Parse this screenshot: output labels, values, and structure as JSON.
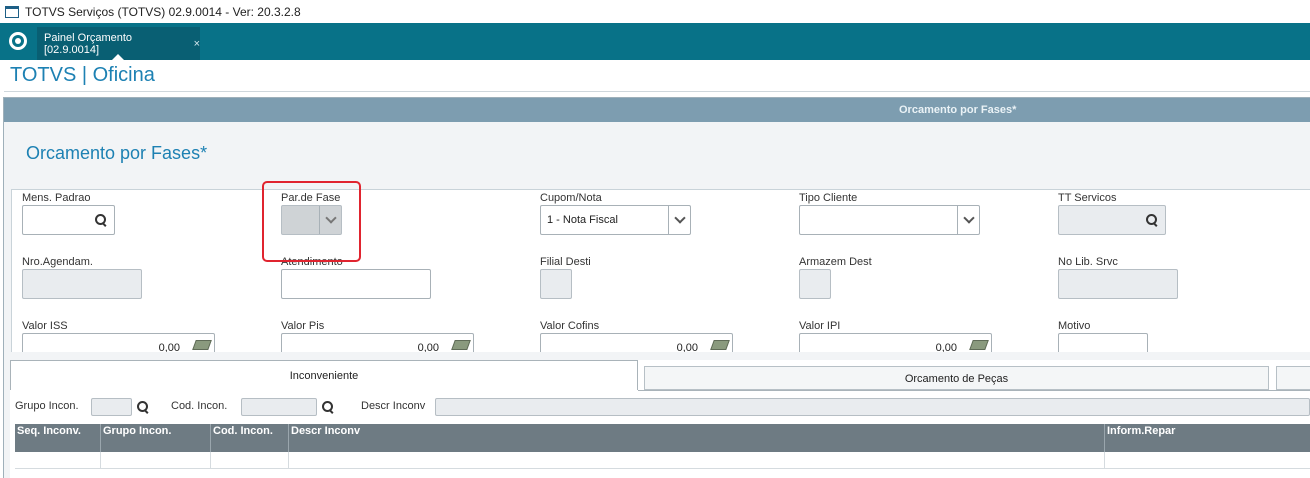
{
  "window": {
    "title": "TOTVS Serviços (TOTVS) 02.9.0014 - Ver: 20.3.2.8"
  },
  "topnav": {
    "tab_label": "Painel Orçamento [02.9.0014]",
    "tab_close": "×"
  },
  "app": {
    "title": "TOTVS | Oficina"
  },
  "dialog": {
    "header": "Orcamento por Fases*",
    "title": "Orcamento por Fases*"
  },
  "fields": {
    "mens_padrao": {
      "label": "Mens. Padrao",
      "value": ""
    },
    "par_de_fase": {
      "label": "Par.de Fase",
      "value": ""
    },
    "cupom_nota": {
      "label": "Cupom/Nota",
      "value": "1 - Nota Fiscal"
    },
    "tipo_cliente": {
      "label": "Tipo Cliente",
      "value": ""
    },
    "tt_servicos": {
      "label": "TT Servicos",
      "value": ""
    },
    "nro_agendam": {
      "label": "Nro.Agendam.",
      "value": ""
    },
    "atendimento": {
      "label": "Atendimento",
      "value": ""
    },
    "filial_desti": {
      "label": "Filial Desti",
      "value": ""
    },
    "armazem_dest": {
      "label": "Armazem Dest",
      "value": ""
    },
    "no_lib_srvc": {
      "label": "No Lib. Srvc",
      "value": ""
    },
    "valor_iss": {
      "label": "Valor ISS",
      "value": "0,00"
    },
    "valor_pis": {
      "label": "Valor Pis",
      "value": "0,00"
    },
    "valor_cofins": {
      "label": "Valor Cofins",
      "value": "0,00"
    },
    "valor_ipi": {
      "label": "Valor IPI",
      "value": "0,00"
    },
    "motivo": {
      "label": "Motivo",
      "value": ""
    }
  },
  "tabs": [
    {
      "label": "Inconveniente",
      "active": true
    },
    {
      "label": "Orcamento de Peças",
      "active": false
    },
    {
      "label": "",
      "active": false
    }
  ],
  "filters": {
    "grupo_incon_label": "Grupo Incon.",
    "cod_incon_label": "Cod. Incon.",
    "descr_inconv_label": "Descr Inconv"
  },
  "grid": {
    "columns": [
      "Seq. Inconv.",
      "Grupo Incon.",
      "Cod. Incon.",
      "Descr Inconv",
      "Inform.Repar"
    ]
  },
  "colors": {
    "nav_bg": "#087288",
    "accent_title": "#1d81b3",
    "dialog_header": "#7d9db0",
    "grid_header": "#6e7b83",
    "highlight": "#e0242f"
  }
}
